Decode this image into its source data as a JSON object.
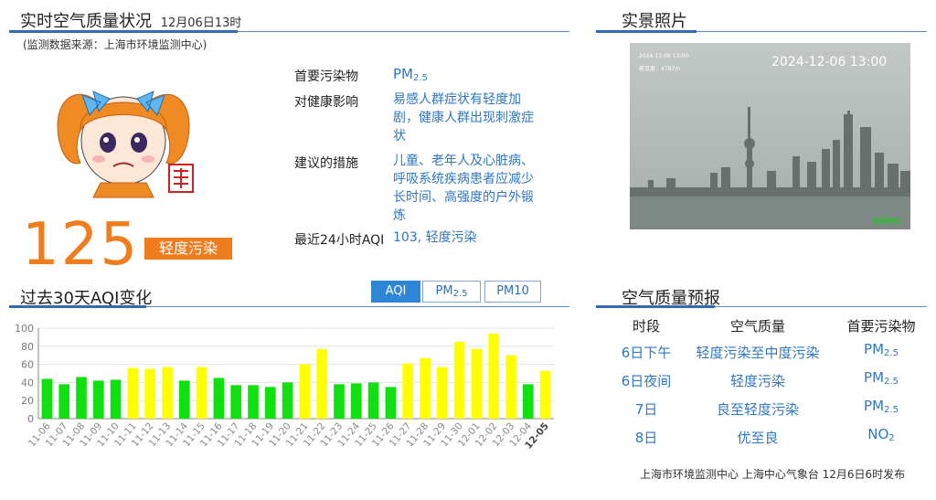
{
  "realtime": {
    "title": "实时空气质量状况",
    "datetime": "12月06日13时",
    "source": "(监测数据来源：上海市环境监测中心)",
    "aqi": "125",
    "level": "轻度污染",
    "badge_color": "#f07d1d",
    "primary_pollutant_label": "首要污染物",
    "primary_pollutant": "PM",
    "primary_pollutant_sub": "2.5",
    "health_label": "对健康影响",
    "health_text": "易感人群症状有轻度加剧，健康人群出现刺激症状",
    "advice_label": "建议的措施",
    "advice_text": "儿童、老年人及心脏病、呼吸系统疾病患者应减少长时间、高强度的户外锻炼",
    "last24_label": "最近24小时AQI",
    "last24_value": "103, 轻度污染"
  },
  "photo": {
    "title": "实景照片",
    "timestamp": "2024-12-06 13:00",
    "overlay_date": "2024-12-06 13:00",
    "overlay_vis": "能见度：4787m",
    "watermark": "SEMC"
  },
  "history": {
    "title": "过去30天AQI变化",
    "tabs": [
      {
        "main": "AQI",
        "sub": "",
        "active": true
      },
      {
        "main": "PM",
        "sub": "2.5",
        "active": false
      },
      {
        "main": "PM",
        "sub": "10",
        "active": false
      }
    ]
  },
  "forecast": {
    "title": "空气质量预报",
    "headers": [
      "时段",
      "空气质量",
      "首要污染物"
    ],
    "rows": [
      {
        "period": "6日下午",
        "quality": "轻度污染至中度污染",
        "pollutant": "PM",
        "sub": "2.5"
      },
      {
        "period": "6日夜间",
        "quality": "轻度污染",
        "pollutant": "PM",
        "sub": "2.5"
      },
      {
        "period": "7日",
        "quality": "良至轻度污染",
        "pollutant": "PM",
        "sub": "2.5"
      },
      {
        "period": "8日",
        "quality": "优至良",
        "pollutant": "NO",
        "sub": "2"
      }
    ],
    "footer": "上海市环境监测中心 上海中心气象台 12月6日6时发布"
  },
  "chart_data": {
    "type": "bar",
    "categories": [
      "11-06",
      "11-07",
      "11-08",
      "11-09",
      "11-10",
      "11-11",
      "11-12",
      "11-13",
      "11-14",
      "11-15",
      "11-16",
      "11-17",
      "11-18",
      "11-19",
      "11-20",
      "11-21",
      "11-22",
      "11-23",
      "11-24",
      "11-25",
      "11-26",
      "11-27",
      "11-28",
      "11-29",
      "11-30",
      "12-01",
      "12-02",
      "12-03",
      "12-04",
      "12-05"
    ],
    "values": [
      44,
      38,
      46,
      42,
      43,
      56,
      55,
      57,
      42,
      57,
      45,
      37,
      37,
      35,
      40,
      60,
      77,
      38,
      39,
      40,
      35,
      61,
      67,
      57,
      85,
      77,
      94,
      70,
      38,
      53
    ],
    "colors": [
      "green",
      "green",
      "green",
      "green",
      "green",
      "yellow",
      "yellow",
      "yellow",
      "green",
      "yellow",
      "green",
      "green",
      "green",
      "green",
      "green",
      "yellow",
      "yellow",
      "green",
      "green",
      "green",
      "green",
      "yellow",
      "yellow",
      "yellow",
      "yellow",
      "yellow",
      "yellow",
      "yellow",
      "green",
      "yellow"
    ],
    "palette": {
      "green": "#10e010",
      "yellow": "#ffff00"
    },
    "yticks": [
      0,
      20,
      40,
      60,
      80,
      100
    ],
    "ylim": [
      0,
      100
    ],
    "grid": true,
    "highlight_last_label": true
  }
}
